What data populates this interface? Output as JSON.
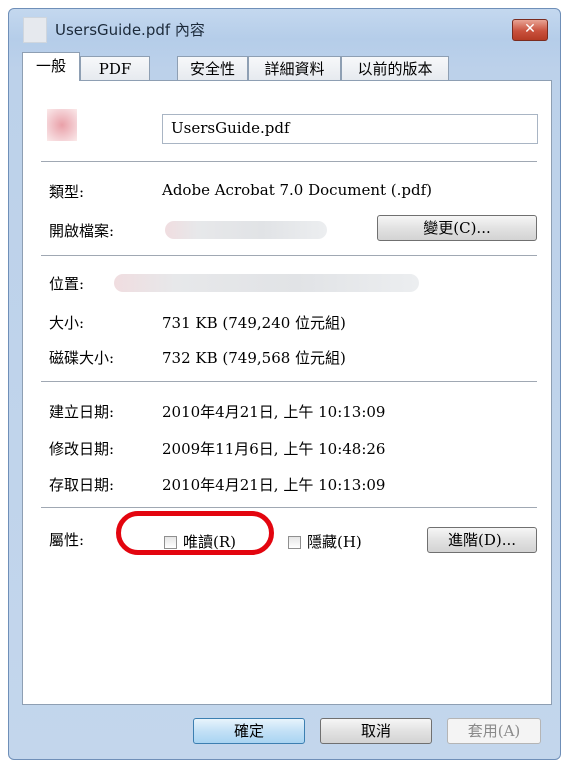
{
  "window": {
    "title": "UsersGuide.pdf 內容",
    "close_label": "✕"
  },
  "tabs": [
    "一般",
    "PDF",
    "安全性",
    "詳細資料",
    "以前的版本"
  ],
  "file": {
    "name": "UsersGuide.pdf"
  },
  "labels": {
    "type": "類型:",
    "open_with": "開啟檔案:",
    "location": "位置:",
    "size": "大小:",
    "size_on_disk": "磁碟大小:",
    "created": "建立日期:",
    "modified": "修改日期:",
    "accessed": "存取日期:",
    "attributes": "屬性:"
  },
  "values": {
    "type": "Adobe Acrobat 7.0 Document (.pdf)",
    "size": "731 KB (749,240 位元組)",
    "size_on_disk": "732 KB (749,568 位元組)",
    "created": "2010年4月21日, 上午 10:13:09",
    "modified": "2009年11月6日, 上午 10:48:26",
    "accessed": "2010年4月21日, 上午 10:13:09"
  },
  "buttons": {
    "change": "變更(C)...",
    "advanced": "進階(D)...",
    "ok": "確定",
    "cancel": "取消",
    "apply": "套用(A)"
  },
  "attributes": {
    "readonly_label": "唯讀(R)",
    "readonly_checked": false,
    "hidden_label": "隱藏(H)",
    "hidden_checked": false
  },
  "colors": {
    "highlight": "#e3050f",
    "titlebar": "#b5cde9",
    "close": "#c9513d"
  }
}
